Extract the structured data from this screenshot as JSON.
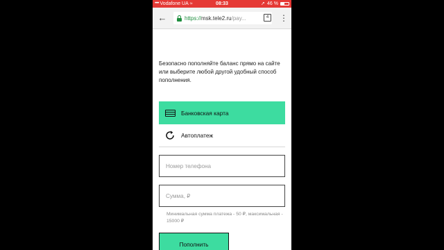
{
  "status_bar": {
    "signal": "•••••",
    "carrier": "Vodafone UA",
    "wifi": "≈",
    "time": "08:33",
    "battery": "46 %",
    "battery_level": 0.46
  },
  "browser": {
    "url_scheme": "https://",
    "url_host": "msk.tele2.ru",
    "url_path": "/pay...",
    "tab_count": "4"
  },
  "page": {
    "intro_text": "Безопасно пополняйте баланс прямо на сайте или выберите любой другой удобный способ пополнения.",
    "methods": [
      {
        "label": "Банковская карта",
        "icon": "credit-card-icon",
        "selected": true
      },
      {
        "label": "Автоплатеж",
        "icon": "refresh-icon",
        "selected": false
      }
    ],
    "phone_placeholder": "Номер телефона",
    "amount_placeholder": "Сумма, ₽",
    "hint_text": "Минимальная сумма платежа - 50 ₽, максимальная - 15000 ₽",
    "submit_label": "Пополнить"
  },
  "colors": {
    "status_bar": "#e53935",
    "accent": "#3ddca0",
    "secure_green": "#1e8e3e"
  }
}
